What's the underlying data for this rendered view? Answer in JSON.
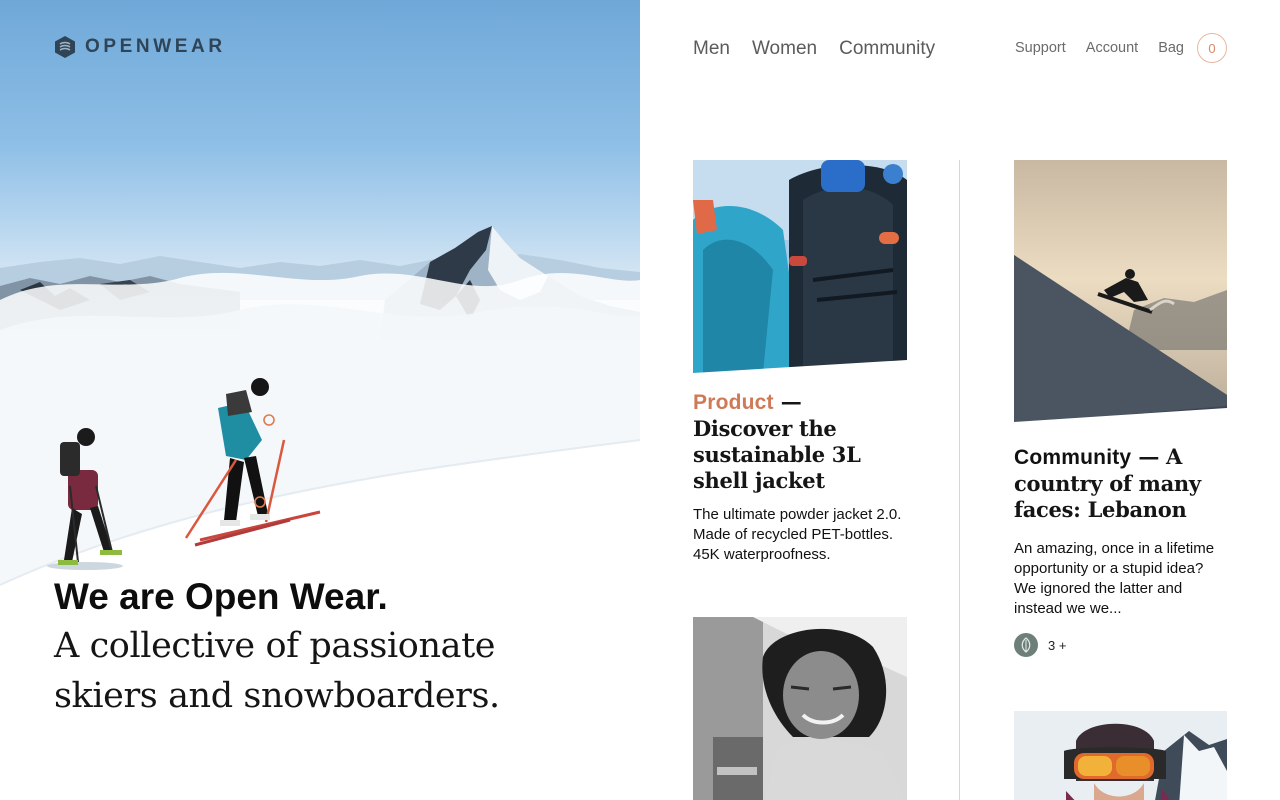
{
  "brand": {
    "name": "OPENWEAR",
    "logo_icon": "openwear-logo-icon"
  },
  "hero": {
    "title": "We are Open Wear.",
    "subtitle_line1": "A collective of passionate",
    "subtitle_line2": "skiers and snowboarders."
  },
  "nav": {
    "main": [
      {
        "label": "Men"
      },
      {
        "label": "Women"
      },
      {
        "label": "Community"
      }
    ],
    "support": "Support",
    "account": "Account",
    "bag": "Bag",
    "bag_count": "0"
  },
  "cards": {
    "product": {
      "tag": "Product",
      "headline": " — Discover the sustainable 3L shell jacket",
      "body": "The ultimate powder jacket 2.0. Made of recycled PET-bottles. 45K waterproofness."
    },
    "community": {
      "tag": "Community",
      "headline": " — A country of many faces: Lebanon",
      "body": "An amazing, once in a lifetime opportunity or a stupid idea? We ignored the latter and instead we we...",
      "comment_count": "3 +"
    }
  },
  "colors": {
    "accent": "#cf7a56",
    "brand_text": "#2f4557",
    "divider": "#e3d3c7"
  }
}
